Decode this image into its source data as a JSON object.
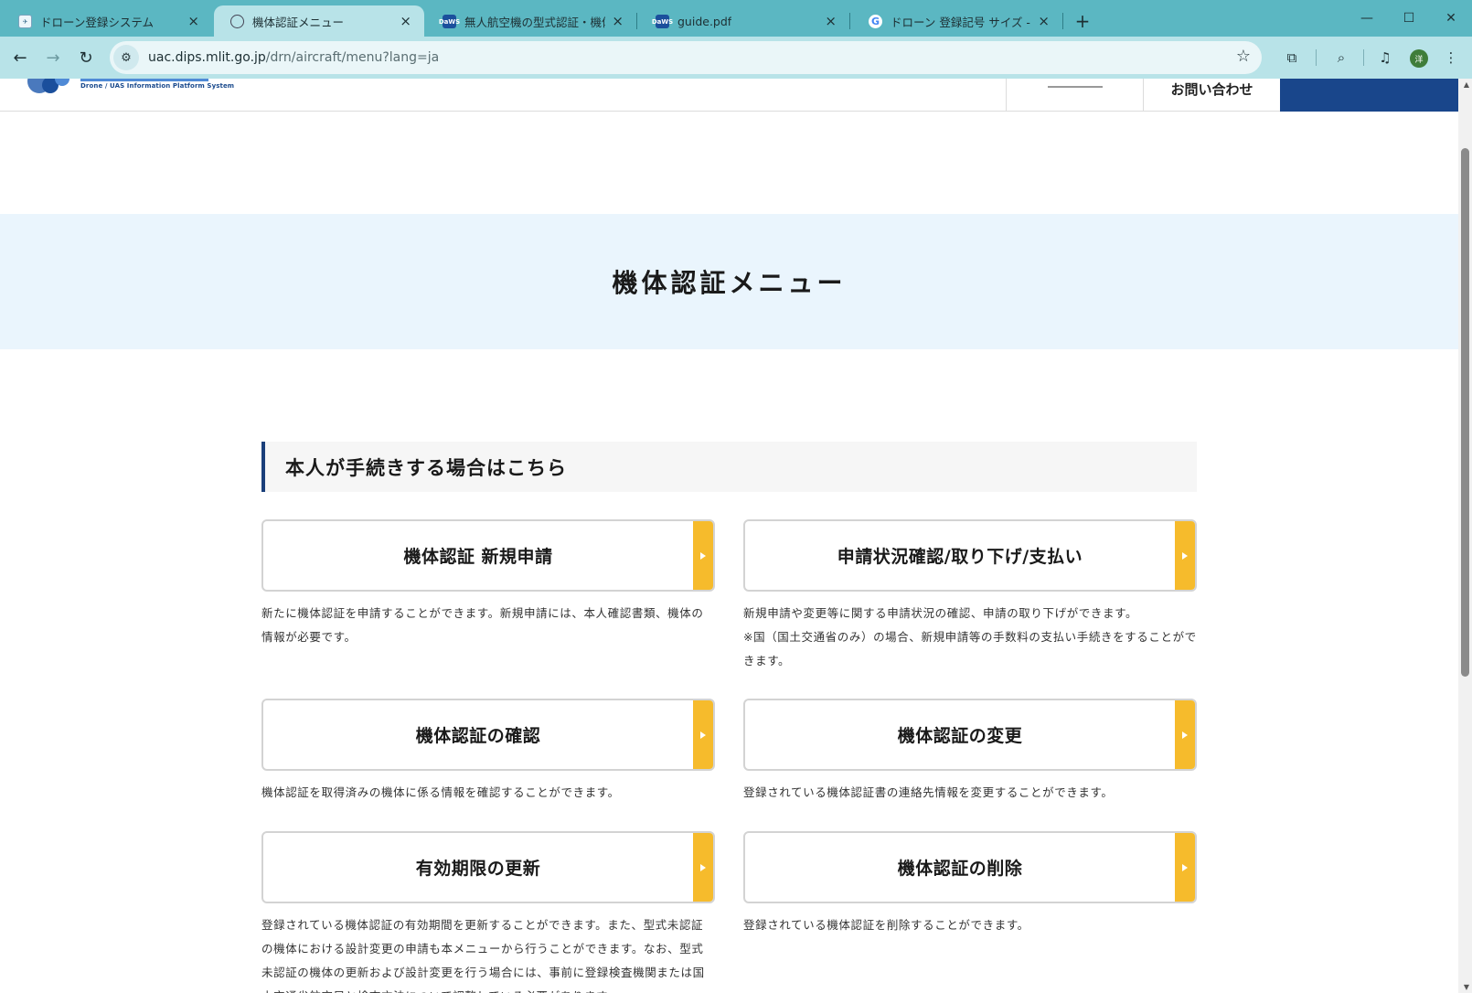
{
  "browser": {
    "tabs": [
      {
        "title": "ドローン登録システム",
        "favicon": "app-icon",
        "active": false
      },
      {
        "title": "機体認証メニュー",
        "favicon": "globe-icon",
        "active": true
      },
      {
        "title": "無人航空機の型式認証・機体認証",
        "favicon": "dipsa-icon",
        "favicon_text": "DaWS",
        "active": false
      },
      {
        "title": "guide.pdf",
        "favicon": "dipsa-icon",
        "favicon_text": "DaWS",
        "active": false
      },
      {
        "title": "ドローン 登録記号 サイズ - Google",
        "favicon": "google-icon",
        "favicon_text": "G",
        "active": false
      }
    ],
    "new_tab": "+",
    "close_glyph": "×",
    "address": {
      "host": "uac.dips.mlit.go.jp",
      "path": "/drn/aircraft/menu?lang=ja"
    },
    "profile_initial": "洋"
  },
  "header": {
    "logo_caption": "Drone / UAS Information Platform System",
    "contact": "お問い合わせ"
  },
  "hero": {
    "title": "機体認証メニュー"
  },
  "section": {
    "title": "本人が手続きする場合はこちら"
  },
  "menu": [
    {
      "label": "機体認証 新規申請",
      "desc": "新たに機体認証を申請することができます。新規申請には、本人確認書類、機体の情報が必要です。"
    },
    {
      "label": "申請状況確認/取り下げ/支払い",
      "desc": "新規申請や変更等に関する申請状況の確認、申請の取り下げができます。",
      "desc2": "※国（国土交通省のみ）の場合、新規申請等の手数料の支払い手続きをすることができます。"
    },
    {
      "label": "機体認証の確認",
      "desc": "機体認証を取得済みの機体に係る情報を確認することができます。"
    },
    {
      "label": "機体認証の変更",
      "desc": "登録されている機体認証書の連絡先情報を変更することができます。"
    },
    {
      "label": "有効期限の更新",
      "desc": "登録されている機体認証の有効期間を更新することができます。また、型式未認証の機体における設計変更の申請も本メニューから行うことができます。なお、型式未認証の機体の更新および設計変更を行う場合には、事前に登録検査機関または国土交通省航空局と検査方法について調整している必要があります。"
    },
    {
      "label": "機体認証の削除",
      "desc": "登録されている機体認証を削除することができます。"
    }
  ],
  "colors": {
    "tabbar": "#5bb7c2",
    "toolbar": "#b8e3e8",
    "hero_bg": "#eaf5fd",
    "accent_arrow": "#f6bb2c",
    "header_login": "#19468b",
    "section_bar": "#1a3f7a"
  }
}
